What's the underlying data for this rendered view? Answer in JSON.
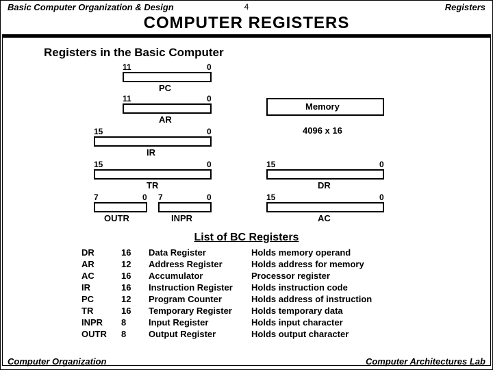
{
  "header": {
    "left": "Basic Computer Organization & Design",
    "page": "4",
    "right": "Registers"
  },
  "title": "COMPUTER  REGISTERS",
  "subhead": "Registers in the Basic Computer",
  "regs": {
    "pc": {
      "hi": "11",
      "lo": "0",
      "name": "PC"
    },
    "ar": {
      "hi": "11",
      "lo": "0",
      "name": "AR"
    },
    "ir": {
      "hi": "15",
      "lo": "0",
      "name": "IR"
    },
    "tr": {
      "hi": "15",
      "lo": "0",
      "name": "TR"
    },
    "outr": {
      "hi": "7",
      "lo": "0",
      "name": "OUTR"
    },
    "inpr": {
      "hi": "7",
      "lo": "0",
      "name": "INPR"
    },
    "dr": {
      "hi": "15",
      "lo": "0",
      "name": "DR"
    },
    "ac": {
      "hi": "15",
      "lo": "0",
      "name": "AC"
    }
  },
  "memory": {
    "label": "Memory",
    "size": "4096 x 16"
  },
  "list_title": "List of BC Registers",
  "list": [
    {
      "sym": "DR",
      "bits": "16",
      "name": "Data Register",
      "desc": "Holds memory operand"
    },
    {
      "sym": "AR",
      "bits": "12",
      "name": "Address Register",
      "desc": "Holds address for memory"
    },
    {
      "sym": "AC",
      "bits": "16",
      "name": "Accumulator",
      "desc": "        Processor register"
    },
    {
      "sym": "IR",
      "bits": "16",
      "name": "Instruction Register",
      "desc": "Holds instruction code"
    },
    {
      "sym": "PC",
      "bits": "12",
      "name": "Program Counter",
      "desc": "Holds address of instruction"
    },
    {
      "sym": "TR",
      "bits": "16",
      "name": "Temporary Register",
      "desc": "Holds temporary data"
    },
    {
      "sym": "INPR",
      "bits": "8",
      "name": " Input Register",
      "desc": "Holds input character"
    },
    {
      "sym": "OUTR",
      "bits": "8",
      "name": "Output Register",
      "desc": "Holds output character"
    }
  ],
  "footer": {
    "left": "Computer Organization",
    "right": "Computer Architectures Lab"
  }
}
